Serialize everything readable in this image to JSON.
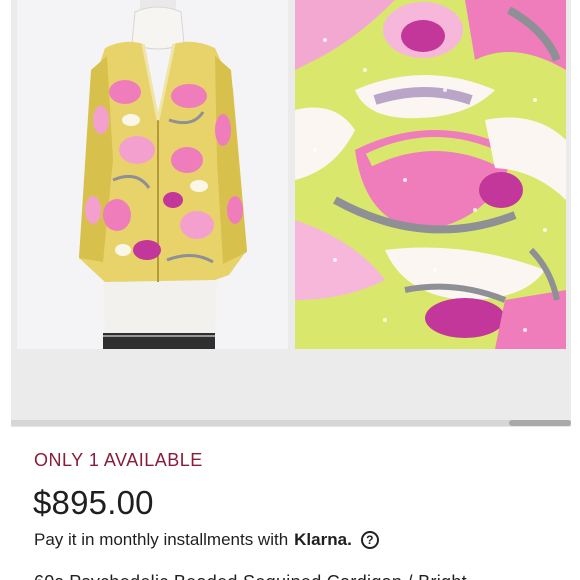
{
  "gallery": {
    "images": [
      {
        "alt": "Sequined jacket on dress form"
      },
      {
        "alt": "Sequin pattern close-up"
      }
    ]
  },
  "listing": {
    "availability": "ONLY 1 AVAILABLE",
    "price": "$895.00",
    "installments_text": "Pay it in monthly installments with",
    "installments_provider": "Klarna.",
    "help_glyph": "?",
    "title_partial": "60s Psychedelic Beaded Sequined Cardigan / Bright"
  },
  "colors": {
    "availability": "#8a1c3a",
    "pink": "#f07dbb",
    "magenta": "#c3379a",
    "chartreuse": "#cfe04a",
    "gray_bead": "#8f8f96"
  },
  "icons": {
    "help": "question-circle-icon"
  }
}
